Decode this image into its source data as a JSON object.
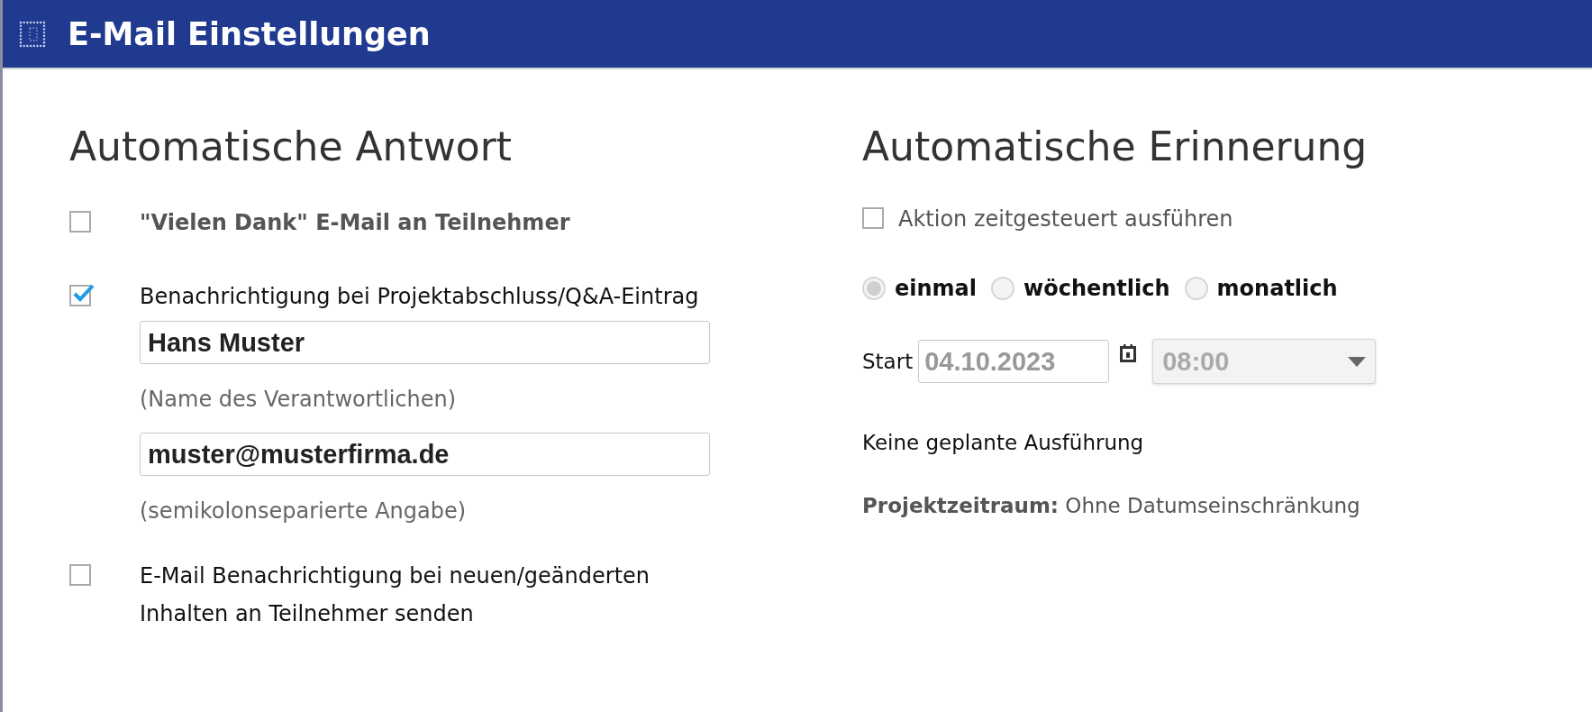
{
  "window": {
    "title": "E-Mail Einstellungen"
  },
  "auto_reply": {
    "heading": "Automatische Antwort",
    "options": [
      {
        "kind": "checkbox",
        "label": "\"Vielen Dank\" E-Mail an Teilnehmer",
        "checked": false,
        "muted": true
      },
      {
        "kind": "checkbox",
        "label": "Benachrichtigung bei Projektabschluss/Q&A-Eintrag",
        "checked": true,
        "muted": false,
        "fields": [
          {
            "value": "Hans Muster",
            "hint": "(Name des Verantwortlichen)"
          },
          {
            "value": "muster@musterfirma.de",
            "hint": "(semikolonseparierte Angabe)"
          }
        ]
      },
      {
        "kind": "checkbox",
        "label": "E-Mail Benachrichtigung bei neuen/geänderten Inhalten an Teilnehmer senden",
        "checked": false,
        "muted": false
      }
    ]
  },
  "reminder": {
    "heading": "Automatische Erinnerung",
    "scheduled": {
      "label": "Aktion zeitgesteuert ausführen",
      "checked": false
    },
    "frequency": [
      {
        "label": "einmal",
        "selected": true
      },
      {
        "label": "wöchentlich",
        "selected": false
      },
      {
        "label": "monatlich",
        "selected": false
      }
    ],
    "start": {
      "label": "Start",
      "date": "04.10.2023",
      "time": "08:00",
      "disabled": true
    },
    "status": "Keine geplante Ausführung",
    "period": "**Projektzeitraum:** Ohne Datumseinschränkung"
  }
}
